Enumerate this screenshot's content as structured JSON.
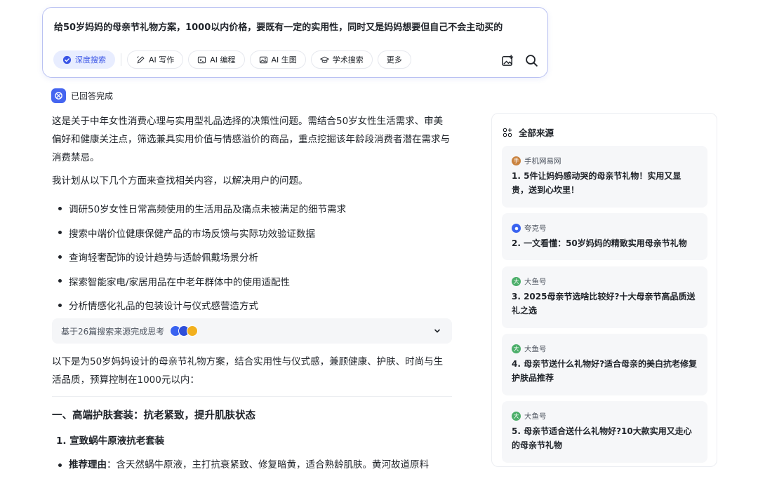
{
  "search": {
    "query": "给50岁妈妈的母亲节礼物方案，1000以内价格，要既有一定的实用性，同时又是妈妈想要但自己不会主动买的",
    "chips": [
      {
        "label": "深度搜索",
        "icon": "deep-search-icon",
        "active": true
      },
      {
        "label": "AI 写作",
        "icon": "pen-icon",
        "active": false
      },
      {
        "label": "AI 编程",
        "icon": "code-icon",
        "active": false
      },
      {
        "label": "AI 生图",
        "icon": "image-icon",
        "active": false
      },
      {
        "label": "学术搜索",
        "icon": "graduation-cap-icon",
        "active": false
      },
      {
        "label": "更多",
        "icon": "",
        "active": false
      }
    ]
  },
  "status": {
    "text": "已回答完成"
  },
  "answer": {
    "intro": "这是关于中年女性消费心理与实用型礼品选择的决策性问题。需结合50岁女性生活需求、审美偏好和健康关注点，筛选兼具实用价值与情感溢价的商品，重点挖掘该年龄段消费者潜在需求与消费禁忌。",
    "plan": "我计划从以下几个方面来查找相关内容，以解决用户的问题。",
    "bullets": [
      "调研50岁女性日常高频使用的生活用品及痛点未被满足的细节需求",
      "搜索中端价位健康保健产品的市场反馈与实际功效验证数据",
      "查询轻奢配饰的设计趋势与适龄佩戴场景分析",
      "探索智能家电/家居用品在中老年群体中的使用适配性",
      "分析情感化礼品的包装设计与仪式感营造方式"
    ],
    "thinking": "基于26篇搜索来源完成思考",
    "summary": "以下是为50岁妈妈设计的母亲节礼物方案，结合实用性与仪式感，兼顾健康、护肤、时尚与生活品质，预算控制在1000元以内：",
    "section_title": "一、高端护肤套装：抗老紧致，提升肌肤状态",
    "item_title": "1. 宣致蜗牛原液抗老套装",
    "rec_label": "推荐理由",
    "rec_text": "：含天然蜗牛原液，主打抗衰紧致、修复暗黄，适合熟龄肌肤。黄河故道原料"
  },
  "sources": {
    "header": "全部来源",
    "items": [
      {
        "site": "手机网易网",
        "site_icon_char": "手",
        "color": "#c9813c",
        "title": "1. 5件让妈妈感动哭的母亲节礼物！实用又显贵，送到心坎里！"
      },
      {
        "site": "夸克号",
        "site_icon_char": "",
        "color": "#3a63f0",
        "title": "2. 一文看懂：50岁妈妈的精致实用母亲节礼物"
      },
      {
        "site": "大鱼号",
        "site_icon_char": "大",
        "color": "#4caf6a",
        "title": "3. 2025母亲节选啥比较好?十大母亲节高品质送礼之选"
      },
      {
        "site": "大鱼号",
        "site_icon_char": "大",
        "color": "#4caf6a",
        "title": "4. 母亲节送什么礼物好?适合母亲的美白抗老修复护肤品推荐"
      },
      {
        "site": "大鱼号",
        "site_icon_char": "大",
        "color": "#4caf6a",
        "title": "5. 母亲节适合送什么礼物好?10大款实用又走心的母亲节礼物"
      }
    ]
  },
  "colors": {
    "accent": "#3a55e6",
    "chip_active_bg": "#e8edff"
  }
}
